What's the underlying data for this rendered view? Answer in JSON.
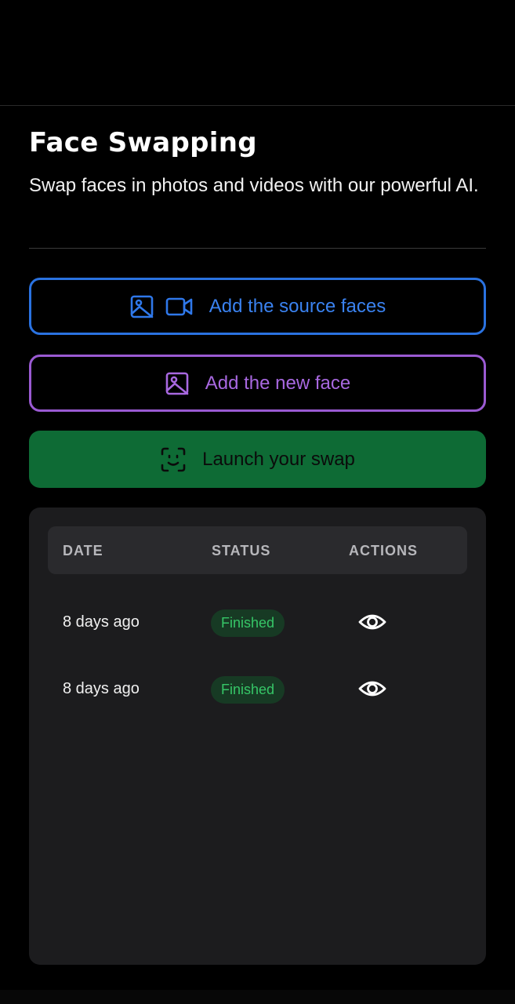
{
  "page": {
    "title": "Face Swapping",
    "subtitle": "Swap faces in photos and videos with our powerful AI."
  },
  "buttons": {
    "source": {
      "label": "Add the source faces",
      "icons": [
        "image-icon",
        "video-icon"
      ],
      "color": "#2a72e0"
    },
    "new_face": {
      "label": "Add the new face",
      "icons": [
        "image-icon"
      ],
      "color": "#9a5ad2"
    },
    "launch": {
      "label": "Launch your swap",
      "icons": [
        "face-scan-icon"
      ],
      "color": "#0e6b35"
    }
  },
  "table": {
    "columns": [
      "DATE",
      "STATUS",
      "ACTIONS"
    ],
    "rows": [
      {
        "date": "8 days ago",
        "status": "Finished",
        "action_icon": "eye-icon"
      },
      {
        "date": "8 days ago",
        "status": "Finished",
        "action_icon": "eye-icon"
      }
    ],
    "status_color": "#36c667"
  }
}
